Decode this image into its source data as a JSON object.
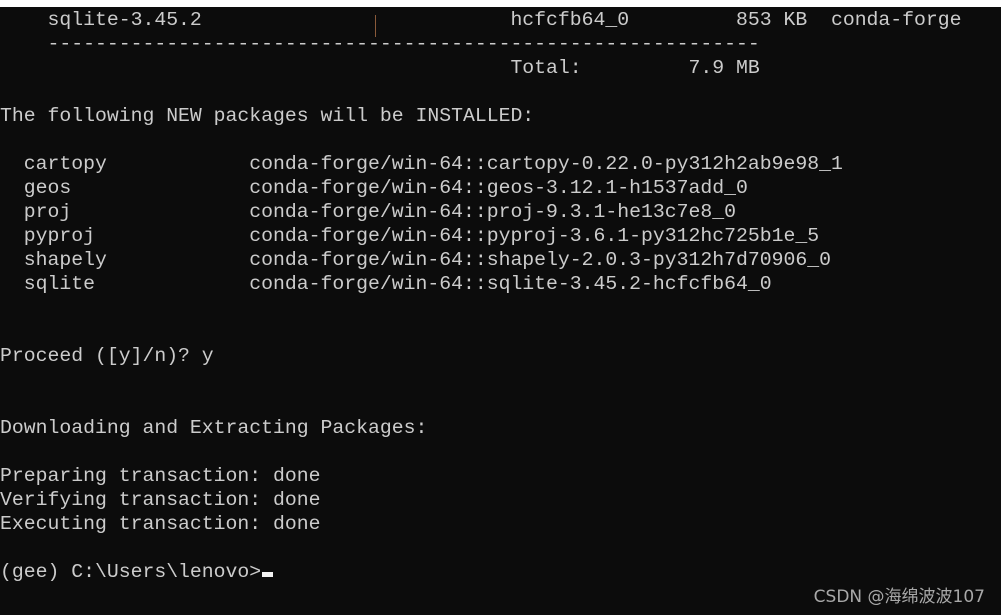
{
  "terminal": {
    "lines": [
      "    sqlite-3.45.2                          hcfcfb64_0         853 KB  conda-forge",
      "    ------------------------------------------------------------",
      "                                           Total:         7.9 MB",
      "",
      "The following NEW packages will be INSTALLED:",
      "",
      "  cartopy            conda-forge/win-64::cartopy-0.22.0-py312h2ab9e98_1",
      "  geos               conda-forge/win-64::geos-3.12.1-h1537add_0",
      "  proj               conda-forge/win-64::proj-9.3.1-he13c7e8_0",
      "  pyproj             conda-forge/win-64::pyproj-3.6.1-py312hc725b1e_5",
      "  shapely            conda-forge/win-64::shapely-2.0.3-py312h7d70906_0",
      "  sqlite             conda-forge/win-64::sqlite-3.45.2-hcfcfb64_0",
      "",
      "",
      "Proceed ([y]/n)? y",
      "",
      "",
      "Downloading and Extracting Packages:",
      "",
      "Preparing transaction: done",
      "Verifying transaction: done",
      "Executing transaction: done",
      "",
      "(gee) C:\\Users\\lenovo>"
    ]
  },
  "watermark": "CSDN @海绵波波107"
}
